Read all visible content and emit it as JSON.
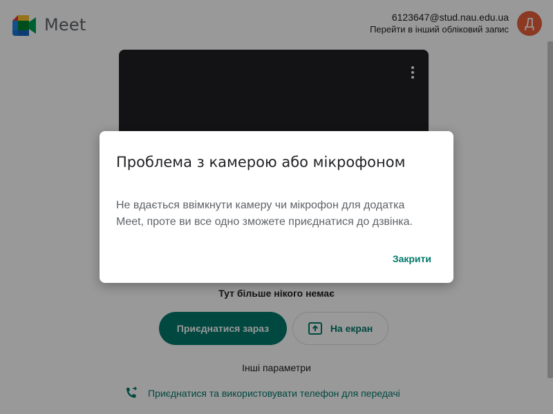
{
  "app": {
    "name": "Meet"
  },
  "account": {
    "email": "6123647@stud.nau.edu.ua",
    "switch_label": "Перейти в інший обліковий запис",
    "avatar_letter": "Д",
    "avatar_color": "#e8603b"
  },
  "preview": {
    "more_icon": "more-vert-icon"
  },
  "main": {
    "nobody_text": "Тут більше нікого немає",
    "join_button": "Приєднатися зараз",
    "present_button": "На екран",
    "other_options": "Інші параметри",
    "phone_link": "Приєднатися та використовувати телефон для передачі"
  },
  "dialog": {
    "title": "Проблема з камерою або мікрофоном",
    "body": "Не вдається ввімкнути камеру чи мікрофон для додатка Meet, проте ви все одно зможете приєднатися до дзвінка.",
    "close_button": "Закрити"
  },
  "colors": {
    "accent": "#00796b",
    "overlay": "rgba(0,0,0,0.4)"
  }
}
